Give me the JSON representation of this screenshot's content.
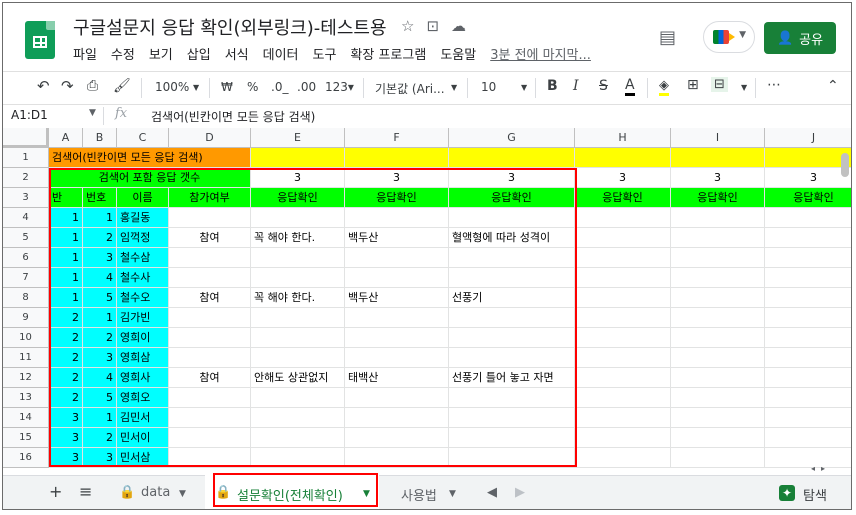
{
  "doc_title": "구글설문지 응답 확인(외부링크)-테스트용",
  "title_icons": [
    "star-icon",
    "folder-move-icon",
    "cloud-status-icon"
  ],
  "menu": [
    "파일",
    "수정",
    "보기",
    "삽입",
    "서식",
    "데이터",
    "도구",
    "확장 프로그램",
    "도움말"
  ],
  "last_edit": "3분 전에 마지막...",
  "share_label": "공유",
  "toolbar": {
    "zoom": "100%",
    "currency": "₩",
    "percent": "%",
    "dec_less": ".0_",
    "dec_more": ".00",
    "num_format": "123▾",
    "font": "기본값 (Ari...",
    "font_size": "10",
    "bold": "B",
    "italic": "I",
    "strike": "S",
    "text_color": "A",
    "more": "⋯",
    "collapse": "⌃"
  },
  "formula_bar": {
    "name_box": "A1:D1",
    "fx": "fx",
    "content": "검색어(빈칸이면 모든 응답 검색)"
  },
  "columns": [
    "A",
    "B",
    "C",
    "D",
    "E",
    "F",
    "G",
    "H",
    "I",
    "J"
  ],
  "rows": [
    "1",
    "2",
    "3",
    "4",
    "5",
    "6",
    "7",
    "8",
    "9",
    "10",
    "11",
    "12",
    "13",
    "14",
    "15",
    "16"
  ],
  "cells": {
    "r1": "검색어(빈칸이면 모든 응답 검색)",
    "r2_label": "검색어 포함 응답 갯수",
    "r2_counts": [
      "3",
      "3",
      "3",
      "3",
      "3",
      "3"
    ],
    "headers": [
      "반",
      "번호",
      "이름",
      "참가여부",
      "응답확인",
      "응답확인",
      "응답확인",
      "응답확인",
      "응답확인",
      "응답확인"
    ],
    "students": [
      {
        "ban": "1",
        "num": "1",
        "name": "홍길동",
        "join": "",
        "e": "",
        "f": "",
        "g": ""
      },
      {
        "ban": "1",
        "num": "2",
        "name": "임꺽정",
        "join": "참여",
        "e": "꼭 해야 한다.",
        "f": "백두산",
        "g": "혈액형에 따라 성격이"
      },
      {
        "ban": "1",
        "num": "3",
        "name": "철수삼",
        "join": "",
        "e": "",
        "f": "",
        "g": ""
      },
      {
        "ban": "1",
        "num": "4",
        "name": "철수사",
        "join": "",
        "e": "",
        "f": "",
        "g": ""
      },
      {
        "ban": "1",
        "num": "5",
        "name": "철수오",
        "join": "참여",
        "e": "꼭 해야 한다.",
        "f": "백두산",
        "g": "선풍기"
      },
      {
        "ban": "2",
        "num": "1",
        "name": "김가빈",
        "join": "",
        "e": "",
        "f": "",
        "g": ""
      },
      {
        "ban": "2",
        "num": "2",
        "name": "영희이",
        "join": "",
        "e": "",
        "f": "",
        "g": ""
      },
      {
        "ban": "2",
        "num": "3",
        "name": "영희삼",
        "join": "",
        "e": "",
        "f": "",
        "g": ""
      },
      {
        "ban": "2",
        "num": "4",
        "name": "영희사",
        "join": "참여",
        "e": "안해도 상관없지",
        "f": "태백산",
        "g": "선풍기 틀어 놓고 자면"
      },
      {
        "ban": "2",
        "num": "5",
        "name": "영희오",
        "join": "",
        "e": "",
        "f": "",
        "g": ""
      },
      {
        "ban": "3",
        "num": "1",
        "name": "김민서",
        "join": "",
        "e": "",
        "f": "",
        "g": ""
      },
      {
        "ban": "3",
        "num": "2",
        "name": "민서이",
        "join": "",
        "e": "",
        "f": "",
        "g": ""
      },
      {
        "ban": "3",
        "num": "3",
        "name": "민서삼",
        "join": "",
        "e": "",
        "f": "",
        "g": ""
      }
    ]
  },
  "colors": {
    "orange": "#ff9900",
    "yellow": "#ffff00",
    "green": "#00ff00",
    "cyan": "#00ffff",
    "highlight": "#ff0000"
  },
  "tabs": {
    "add": "+",
    "all_sheets": "≡",
    "tab1": "data",
    "tab2": "설문확인(전체확인)",
    "tab3": "사용법",
    "explore": "탐색"
  }
}
